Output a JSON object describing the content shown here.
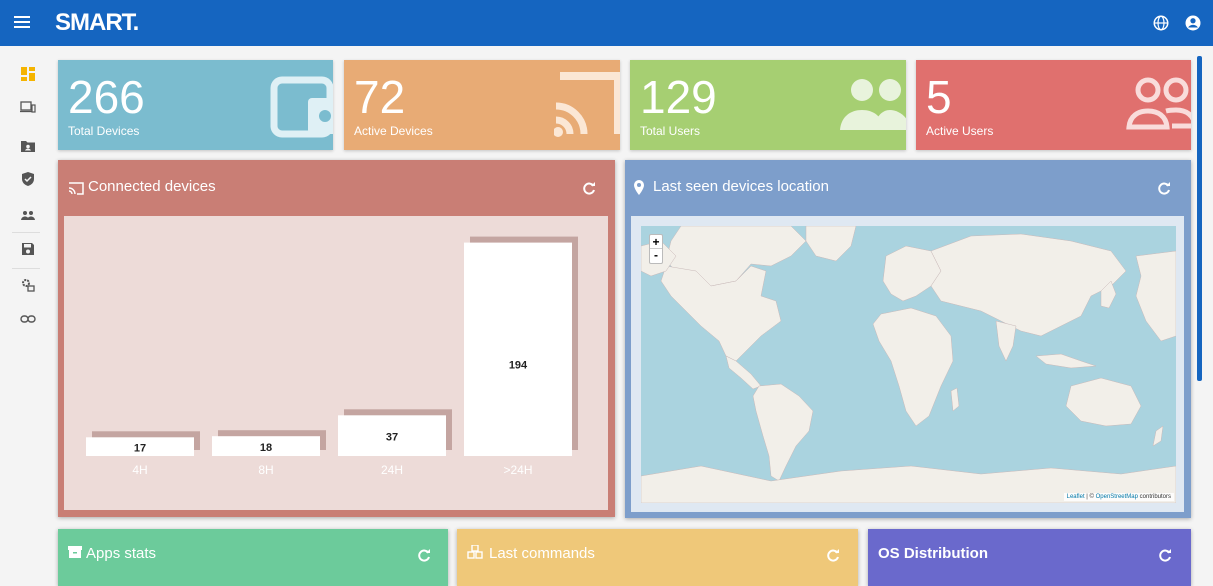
{
  "app": {
    "logo_text": "SMART.",
    "brand_color": "#1565c0"
  },
  "header": {
    "menu_icon": "hamburger-icon",
    "language_icon": "globe-icon",
    "account_icon": "account-circle-icon"
  },
  "sidebar": {
    "items": [
      {
        "icon": "dashboard-icon",
        "active": true
      },
      {
        "icon": "devices-icon"
      },
      {
        "icon": "folder-account-icon"
      },
      {
        "icon": "shield-check-icon"
      },
      {
        "icon": "group-icon"
      },
      {
        "icon": "save-icon"
      },
      {
        "icon": "settings-app-icon"
      },
      {
        "icon": "link-icon"
      }
    ]
  },
  "tiles": [
    {
      "value": "266",
      "label": "Total Devices",
      "color": "#7bbccf",
      "icon": "device-hub-icon"
    },
    {
      "value": "72",
      "label": "Active Devices",
      "color": "#e8ab75",
      "icon": "cast-icon"
    },
    {
      "value": "129",
      "label": "Total Users",
      "color": "#a6cf72",
      "icon": "group-icon"
    },
    {
      "value": "5",
      "label": "Active Users",
      "color": "#e0706e",
      "icon": "group-outline-icon"
    }
  ],
  "connected_devices": {
    "title": "Connected devices",
    "color": "#c97e75",
    "icon": "cast-icon",
    "refresh_icon": "refresh-icon"
  },
  "chart_data": {
    "type": "bar",
    "categories": [
      "4H",
      "8H",
      "24H",
      ">24H"
    ],
    "values": [
      17,
      18,
      37,
      194
    ],
    "ylim": [
      0,
      200
    ]
  },
  "location": {
    "title": "Last seen devices location",
    "color": "#7d9ecb",
    "icon": "map-marker-icon",
    "zoom_in": "+",
    "zoom_out": "-",
    "attribution_leaflet": "Leaflet",
    "attribution_sep": " | © ",
    "attribution_osm": "OpenStreetMap",
    "attribution_tail": " contributors"
  },
  "bottom_panels": [
    {
      "title": "Apps stats",
      "color": "#6ccb9b",
      "icon": "archive-icon"
    },
    {
      "title": "Last commands",
      "color": "#efc879",
      "icon": "cubes-icon"
    },
    {
      "title": "OS Distribution",
      "color": "#6a69cc",
      "icon": ""
    }
  ]
}
